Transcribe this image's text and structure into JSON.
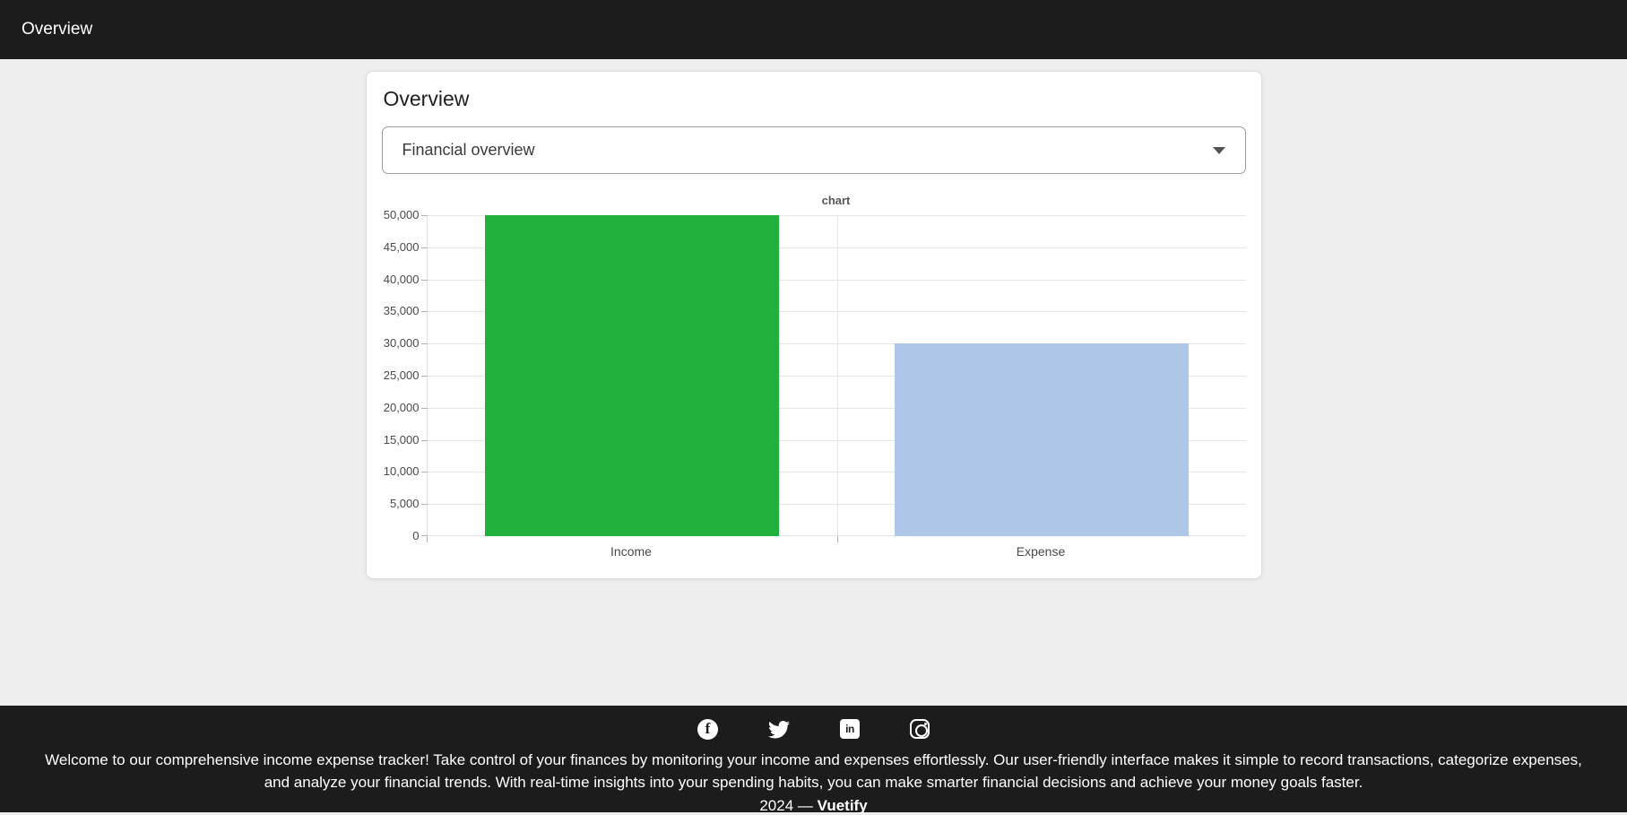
{
  "header": {
    "title": "Overview"
  },
  "card": {
    "title": "Overview",
    "select": {
      "value": "Financial overview"
    }
  },
  "chart_data": {
    "type": "bar",
    "title": "chart",
    "categories": [
      "Income",
      "Expense"
    ],
    "values": [
      50000,
      30000
    ],
    "bar_colors": [
      "#22b13c",
      "#aec6e8"
    ],
    "xlabel": "",
    "ylabel": "",
    "ylim": [
      0,
      50000
    ],
    "y_tick_step": 5000,
    "y_tick_labels": [
      "0",
      "5,000",
      "10,000",
      "15,000",
      "20,000",
      "25,000",
      "30,000",
      "35,000",
      "40,000",
      "45,000",
      "50,000"
    ],
    "grid": true,
    "legend": "none"
  },
  "footer": {
    "icons": [
      "facebook-icon",
      "twitter-icon",
      "linkedin-icon",
      "instagram-icon"
    ],
    "description": "Welcome to our comprehensive income expense tracker! Take control of your finances by monitoring your income and expenses effortlessly. Our user-friendly interface makes it simple to record transactions, categorize expenses, and analyze your financial trends. With real-time insights into your spending habits, you can make smarter financial decisions and achieve your money goals faster.",
    "copyright": {
      "text": "2024 —",
      "brand": "Vuetify"
    }
  },
  "colors": {
    "app_bar_bg": "#1c1c1c",
    "footer_bg": "#1c1c1c",
    "page_bg": "#eeeeee",
    "income_bar": "#22b13c",
    "expense_bar": "#aec6e8"
  }
}
